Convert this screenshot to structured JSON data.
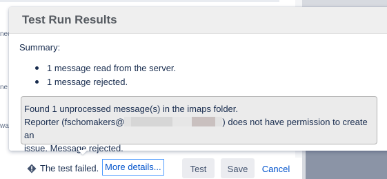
{
  "background": {
    "cropped_texts": [
      "nec",
      "ne a",
      "wa"
    ]
  },
  "dialog": {
    "title": "Test Run Results",
    "summary_label": "Summary:",
    "summary_items": [
      "1 message read from the server.",
      "1 message rejected."
    ],
    "message": {
      "line1": "Found 1 unprocessed message(s) in the imaps folder.",
      "line2_prefix": "Reporter (fschomakers@",
      "line2_suffix": ") does not have permission to create an",
      "line3": "issue. Message rejected."
    }
  },
  "footer": {
    "warning_icon": "warning-icon",
    "status_text": "The test failed.",
    "details_link": "More details...",
    "test_button": "Test",
    "save_button": "Save",
    "cancel_link": "Cancel"
  },
  "colors": {
    "link": "#0052cc",
    "focus_ring": "#4c9aff",
    "header_bg": "#efefef",
    "message_box_bg": "#ebebeb"
  }
}
